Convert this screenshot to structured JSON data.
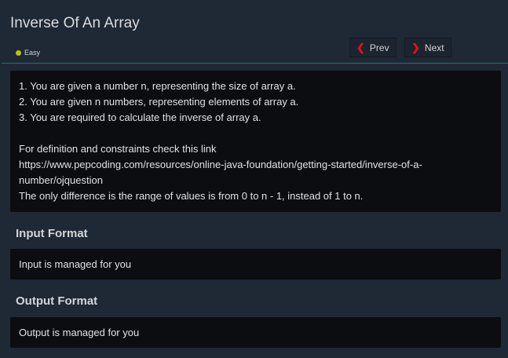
{
  "title": "Inverse Of An Array",
  "difficulty": {
    "label": "Easy",
    "color": "#b5c40c"
  },
  "nav": {
    "prev": "Prev",
    "next": "Next"
  },
  "description": [
    "1. You are given a number n, representing the size of array a.",
    "2. You are given n numbers, representing elements of array a.",
    "3. You are required to calculate the inverse of array a.",
    "",
    "For definition and constraints check this link",
    "https://www.pepcoding.com/resources/online-java-foundation/getting-started/inverse-of-a-",
    "number/ojquestion",
    "The only difference is the range of values is from 0 to n - 1, instead of 1 to n."
  ],
  "input_format": {
    "heading": "Input Format",
    "text": "Input is managed for you"
  },
  "output_format": {
    "heading": "Output Format",
    "text": "Output is managed for you"
  }
}
